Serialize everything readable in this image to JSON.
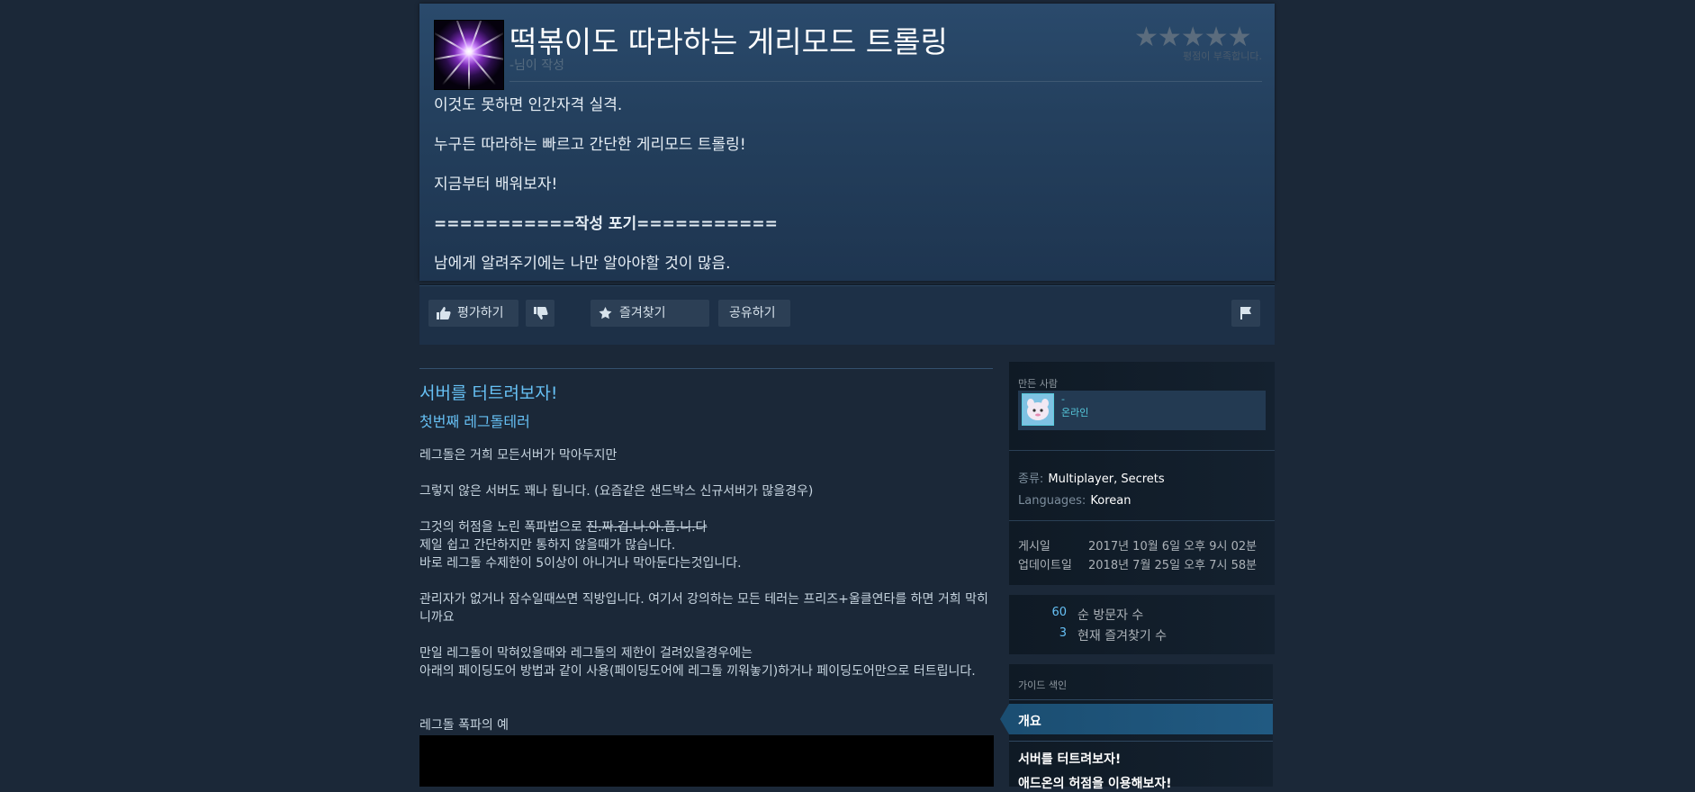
{
  "guide": {
    "title": "떡볶이도 따라하는 게리모드 트롤링",
    "author_line": "-님이 작성",
    "stars": "★★★★★",
    "rating_note": "평점이 부족합니다.",
    "description": [
      "이것도 못하면 인간자격 실격.",
      "누구든 따라하는 빠르고 간단한 게리모드 트롤링!",
      "지금부터 배워보자!",
      "===========작성 포기===========",
      "남에게 알려주기에는 나만 알아야할 것이 많음."
    ]
  },
  "actions": {
    "rate_label": "평가하기",
    "favorite_label": "즐겨찾기",
    "share_label": "공유하기"
  },
  "content": {
    "section_title": "서버를 터트려보자!",
    "subsection_title": "첫번째 레그돌테러",
    "p1": "레그돌은 거희 모든서버가 막아두지만",
    "p2": "그렇지 않은 서버도 꽤나 됩니다. (요즘같은 샌드박스 신규서버가 많을경우)",
    "p3_prefix": "그것의 허점을 노린 폭파법으로 ",
    "p3_strike": "진.짜.겁.나.아.픕.니.다",
    "p4": "제일 쉽고 간단하지만 통하지 않을때가 많습니다.",
    "p5": "바로 레그돌 수제한이 5이상이 아니거나 막아둔다는것입니다.",
    "p6": "관리자가 없거나 잠수일때쓰면 직방입니다. 여기서 강의하는 모든 테러는 프리즈+울클연타를 하면 거희 막히니까요",
    "p7": "만일 레그돌이 막혀있을때와 레그돌의 제한이 걸려있을경우에는",
    "p8": "아래의 페이딩도어 방법과 같이 사용(페이딩도어에 레그돌 끼워놓기)하거나 페이딩도어만으로 터트립니다.",
    "p9": "레그돌 폭파의 예"
  },
  "sidebar": {
    "creator_label": "만든 사람",
    "creator_name": "-",
    "creator_status": "온라인",
    "genre_label": "종류:",
    "genre_1": "Multiplayer",
    "genre_sep": ", ",
    "genre_2": "Secrets",
    "languages_label": "Languages:",
    "languages_value": "Korean",
    "posted_label": "게시일",
    "posted_value": "2017년 10월 6일 오후 9시 02분",
    "updated_label": "업데이트일",
    "updated_value": "2018년 7월 25일 오후 7시 58분",
    "visitors_count": "60",
    "visitors_label": "순 방문자 수",
    "favorites_count": "3",
    "favorites_label": "현재 즐겨찾기 수",
    "index_title": "가이드 색인",
    "index_items": [
      "개요",
      "서버를 터트려보자!",
      "애드온의 허점을 이용해보자!"
    ]
  },
  "colors": {
    "background": "#1b2838",
    "accent_link": "#66c0f4",
    "online_status": "#57cbde"
  }
}
